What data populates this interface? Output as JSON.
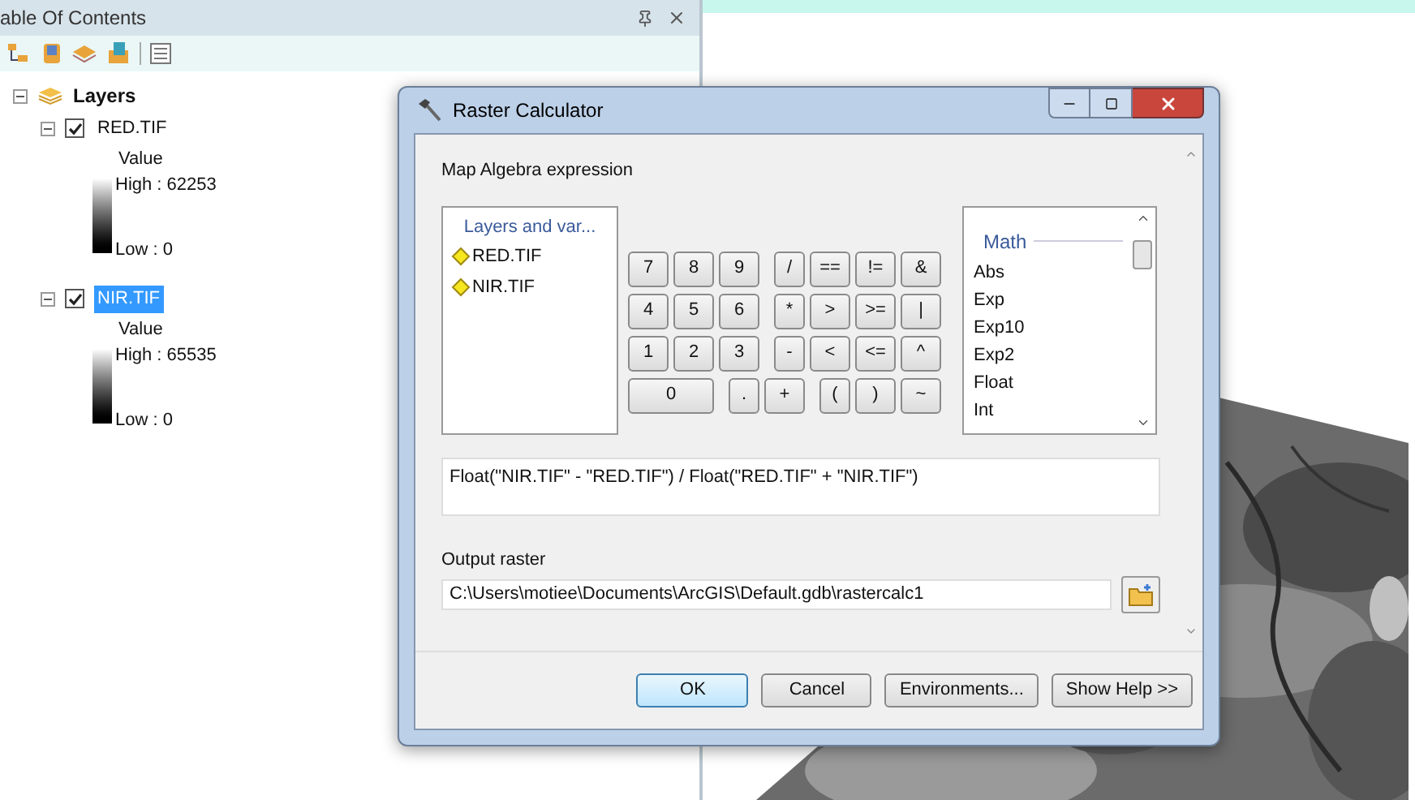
{
  "toc": {
    "title": "able Of Contents",
    "root": {
      "label": "Layers",
      "expanded": true,
      "children": [
        {
          "label": "RED.TIF",
          "expanded": true,
          "checked": true,
          "selected": false,
          "legend": {
            "field": "Value",
            "high": "High : 62253",
            "low": "Low : 0"
          }
        },
        {
          "label": "NIR.TIF",
          "expanded": true,
          "checked": true,
          "selected": true,
          "legend": {
            "field": "Value",
            "high": "High : 65535",
            "low": "Low : 0"
          }
        }
      ]
    }
  },
  "dialog": {
    "title": "Raster Calculator",
    "expression_label": "Map Algebra expression",
    "layers_header": "Layers and var...",
    "layers": [
      "RED.TIF",
      "NIR.TIF"
    ],
    "keys": [
      {
        "label": "7",
        "kind": "normal"
      },
      {
        "label": "8",
        "kind": "normal"
      },
      {
        "label": "9",
        "kind": "normal"
      },
      {
        "label": "/",
        "kind": "normal"
      },
      {
        "label": "==",
        "kind": "normal"
      },
      {
        "label": "!=",
        "kind": "normal"
      },
      {
        "label": "&",
        "kind": "normal"
      },
      {
        "label": "4",
        "kind": "normal"
      },
      {
        "label": "5",
        "kind": "normal"
      },
      {
        "label": "6",
        "kind": "normal"
      },
      {
        "label": "*",
        "kind": "normal"
      },
      {
        "label": ">",
        "kind": "normal"
      },
      {
        "label": ">=",
        "kind": "normal"
      },
      {
        "label": "|",
        "kind": "normal"
      },
      {
        "label": "1",
        "kind": "normal"
      },
      {
        "label": "2",
        "kind": "normal"
      },
      {
        "label": "3",
        "kind": "normal"
      },
      {
        "label": "-",
        "kind": "normal"
      },
      {
        "label": "<",
        "kind": "normal"
      },
      {
        "label": "<=",
        "kind": "normal"
      },
      {
        "label": "^",
        "kind": "normal"
      },
      {
        "label": "0",
        "kind": "wide"
      },
      {
        "label": ".",
        "kind": "normal"
      },
      {
        "label": "+",
        "kind": "normal"
      },
      {
        "label": "(",
        "kind": "normal"
      },
      {
        "label": ")",
        "kind": "normal"
      },
      {
        "label": "~",
        "kind": "normal"
      }
    ],
    "function_group": "Math",
    "functions": [
      "Abs",
      "Exp",
      "Exp10",
      "Exp2",
      "Float",
      "Int"
    ],
    "expression": "Float(\"NIR.TIF\" - \"RED.TIF\") / Float(\"RED.TIF\" + \"NIR.TIF\")",
    "output_label": "Output raster",
    "output_path": "C:\\Users\\motiee\\Documents\\ArcGIS\\Default.gdb\\rastercalc1",
    "buttons": [
      {
        "label": "OK",
        "default": true
      },
      {
        "label": "Cancel",
        "default": false
      },
      {
        "label": "Environments...",
        "default": false
      },
      {
        "label": "Show Help >>",
        "default": false
      }
    ]
  }
}
